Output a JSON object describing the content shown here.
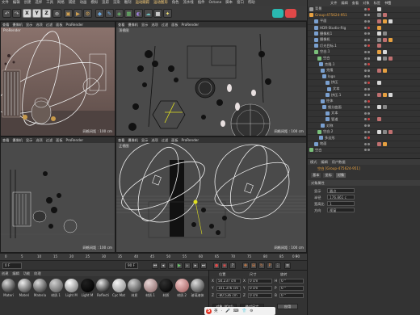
{
  "menu": [
    "文件",
    "编辑",
    "创建",
    "选择",
    "工具",
    "网格",
    "捕捉",
    "动画",
    "模拟",
    "追踪",
    "渲染",
    "雕刻",
    "运动跟踪",
    "运动图形",
    "角色",
    "流水线",
    "插件",
    "Octane",
    "脚本",
    "窗口",
    "帮助"
  ],
  "menu_accent_index": [
    12,
    13
  ],
  "toolbar": {
    "axis_x": "X",
    "axis_y": "Y",
    "axis_z": "Z",
    "icons": [
      "undo-icon",
      "redo-icon",
      "move-icon",
      "scale-icon",
      "rotate-icon",
      "coordinate-icon",
      "render-region-icon",
      "render-view-icon",
      "render-settings-icon",
      "cube-icon",
      "pen-icon",
      "subdivide-icon",
      "array-icon",
      "deformer-icon",
      "environment-icon",
      "camera-icon",
      "light-icon"
    ]
  },
  "viewports": {
    "top_left": {
      "header": [
        "查看",
        "摄像机",
        "显示",
        "选项",
        "过滤",
        "面板",
        "ProRender"
      ],
      "name": "ProRender",
      "grid": "网格间距 : 100 cm"
    },
    "top_right": {
      "header": [
        "查看",
        "摄像机",
        "显示",
        "选项",
        "过滤",
        "面板",
        "ProRender"
      ],
      "name": "顶视图",
      "grid": "网格间距 : 100 cm"
    },
    "bottom_left": {
      "header": [
        "查看",
        "摄像机",
        "显示",
        "选项",
        "过滤",
        "面板",
        "ProRender"
      ],
      "name": "",
      "grid": "网格间距 : 100 cm"
    },
    "bottom_right": {
      "header": [
        "查看",
        "摄像机",
        "显示",
        "选项",
        "过滤",
        "面板",
        "ProRender"
      ],
      "name": "正视图",
      "grid": "网格间距 : 100 cm"
    }
  },
  "objects": {
    "tabs": [
      "文件",
      "编辑",
      "查看",
      "对象",
      "标签",
      "书签"
    ],
    "rows": [
      {
        "label": "背景",
        "color": "#9a9a9a"
      },
      {
        "label": "Group-475624-951",
        "color": "#e6a040",
        "accent": "#e6a040"
      },
      {
        "label": "平面",
        "color": "#7aa0d0"
      },
      {
        "label": "HDR-Studio-Rig",
        "color": "#7aa0d0"
      },
      {
        "label": "摄像机1",
        "color": "#7aa0d0"
      },
      {
        "label": "摄像机",
        "color": "#7aa0d0"
      },
      {
        "label": "灯光目标.1",
        "color": "#7aa0d0"
      },
      {
        "label": "空白.1",
        "color": "#7ac07a"
      },
      {
        "label": "空白",
        "color": "#7ac07a"
      },
      {
        "label": "克隆.1",
        "color": "#7aa0d0"
      },
      {
        "label": "克隆",
        "color": "#7aa0d0"
      },
      {
        "label": "logo",
        "color": "#7aa0d0"
      },
      {
        "label": "挤压",
        "color": "#7aa0d0"
      },
      {
        "label": "文本",
        "color": "#7aa0d0"
      },
      {
        "label": "挤压.1",
        "color": "#7aa0d0"
      },
      {
        "label": "柱体",
        "color": "#7aa0d0"
      },
      {
        "label": "细分曲面",
        "color": "#7aa0d0"
      },
      {
        "label": "文本",
        "color": "#7aa0d0"
      },
      {
        "label": "管道",
        "color": "#7aa0d0"
      },
      {
        "label": "对称",
        "color": "#7aa0d0"
      },
      {
        "label": "空白.2",
        "color": "#7ac07a"
      },
      {
        "label": "多边形",
        "color": "#7aa0d0"
      },
      {
        "label": "地面",
        "color": "#7aa0d0"
      },
      {
        "label": "空白",
        "color": "#7ac07a"
      }
    ]
  },
  "attributes": {
    "tabs": [
      "模式",
      "编辑",
      "用户数据"
    ],
    "title": "空白 [Group-475624-951]",
    "subtabs": [
      "基本",
      "坐标",
      "对象"
    ],
    "section": "对象属性",
    "display_label": "显示",
    "display_value": "圆点",
    "radius_label": "半径",
    "radius_value": "176.861 c",
    "aspect_label": "宽高比",
    "aspect_value": "1",
    "orient_label": "方向",
    "orient_value": "视窗"
  },
  "timeline": {
    "ticks": [
      "0",
      "5",
      "10",
      "15",
      "20",
      "25",
      "30",
      "35",
      "40",
      "45",
      "50",
      "55",
      "60",
      "65",
      "70",
      "75",
      "80",
      "85",
      "90"
    ],
    "end": "0 F"
  },
  "playbar": {
    "start": "0 F",
    "end": "90 F",
    "fps_field": "90 F"
  },
  "materials": {
    "tabs": [
      "创建",
      "编辑",
      "功能",
      "纹理"
    ],
    "items": [
      {
        "label": "Materi",
        "c1": "#d8d8d8",
        "c2": "#3a3a3a"
      },
      {
        "label": "Materi",
        "c1": "#eeeeee",
        "c2": "#555555"
      },
      {
        "label": "Materia",
        "c1": "#dcdcdc",
        "c2": "#4a4a4a"
      },
      {
        "label": "材质.1",
        "c1": "#cfcfcf",
        "c2": "#6a6a6a"
      },
      {
        "label": "Light M",
        "c1": "#ffffff",
        "c2": "#888888"
      },
      {
        "label": "Light M",
        "c1": "#202020",
        "c2": "#050505"
      },
      {
        "label": "Reflecti",
        "c1": "#e4e4e4",
        "c2": "#2a2a2a"
      },
      {
        "label": "Cyc Mat",
        "c1": "#f4f4f4",
        "c2": "#9a9a9a"
      },
      {
        "label": "材质",
        "c1": "#d0d0d0",
        "c2": "#555555"
      },
      {
        "label": "材质.1",
        "c1": "#e8d6d6",
        "c2": "#9a7a7a"
      },
      {
        "label": "材质",
        "c1": "#303030",
        "c2": "#0a0a0a"
      },
      {
        "label": "材质.2",
        "c1": "#f0c8c8",
        "c2": "#b07070"
      },
      {
        "label": "玻璃液体",
        "c1": "#dddddd",
        "c2": "#555555"
      }
    ]
  },
  "coords": {
    "headers": [
      "位置",
      "尺寸",
      "旋转"
    ],
    "rows": [
      {
        "axis": "X",
        "pos": "50.237 cm",
        "size_label": "X",
        "size": "0 cm",
        "rot_label": "H",
        "rot": "0 °"
      },
      {
        "axis": "Y",
        "pos": "101.376 cm",
        "size_label": "Y",
        "size": "0 cm",
        "rot_label": "P",
        "rot": "0 °"
      },
      {
        "axis": "Z",
        "pos": "-80.536 cm",
        "size_label": "Z",
        "size": "0 cm",
        "rot_label": "B",
        "rot": "0 °"
      }
    ],
    "mode": "对象 (相对)",
    "size_mode": "绝对尺寸",
    "apply": "应用"
  },
  "ime": {
    "logo": "S",
    "items": [
      "英",
      "·",
      "🎤",
      "⌨",
      "👕",
      "⚙"
    ]
  }
}
